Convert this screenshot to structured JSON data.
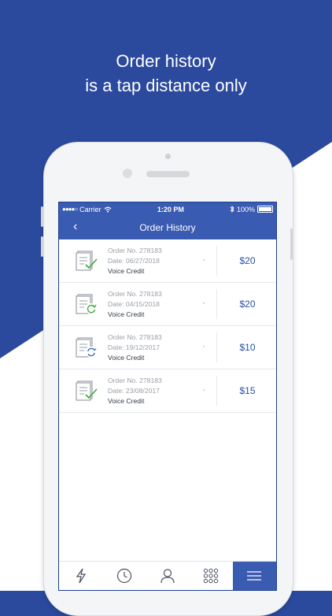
{
  "headline": {
    "line1": "Order history",
    "line2": "is a tap distance only"
  },
  "status_bar": {
    "carrier": "Carrier",
    "time": "1:20 PM",
    "battery": "100%"
  },
  "navbar": {
    "back_glyph": "‹",
    "title": "Order History"
  },
  "orders": [
    {
      "number": "Order No. 278183",
      "date": "Date: 06/27/2018",
      "type": "Voice Credit",
      "amount": "$20",
      "icon": "document-check-icon"
    },
    {
      "number": "Order No. 278183",
      "date": "Date: 04/15/2018",
      "type": "Voice Credit",
      "amount": "$20",
      "icon": "document-refresh-icon"
    },
    {
      "number": "Order No. 278183",
      "date": "Date: 19/12/2017",
      "type": "Voice Credit",
      "amount": "$10",
      "icon": "document-sync-icon"
    },
    {
      "number": "Order No. 278183",
      "date": "Date: 23/08/2017",
      "type": "Voice Credit",
      "amount": "$15",
      "icon": "document-check-icon"
    }
  ],
  "tabs": [
    {
      "name": "lightning-icon",
      "active": false
    },
    {
      "name": "clock-icon",
      "active": false
    },
    {
      "name": "person-icon",
      "active": false
    },
    {
      "name": "keypad-icon",
      "active": false
    },
    {
      "name": "menu-icon",
      "active": true
    }
  ],
  "colors": {
    "brand_blue": "#3a5bb2",
    "amount_blue": "#2b4fa6",
    "check_green": "#3aa83a",
    "sync_blue": "#3a6cc8"
  }
}
